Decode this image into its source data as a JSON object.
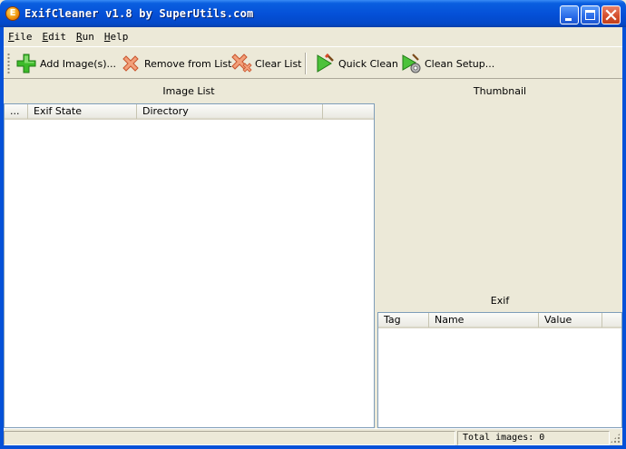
{
  "window": {
    "title": "ExifCleaner v1.8 by SuperUtils.com",
    "app_icon_glyph": "E"
  },
  "menu": [
    {
      "label": "File"
    },
    {
      "label": "Edit"
    },
    {
      "label": "Run"
    },
    {
      "label": "Help"
    }
  ],
  "toolbar": {
    "add_images": "Add Image(s)...",
    "remove_from_list": "Remove from List",
    "clear_list": "Clear List",
    "quick_clean": "Quick Clean",
    "clean_setup": "Clean Setup..."
  },
  "image_list": {
    "title": "Image List",
    "columns": [
      "...",
      "Exif State",
      "Directory",
      ""
    ]
  },
  "thumbnail": {
    "title": "Thumbnail"
  },
  "exif": {
    "title": "Exif",
    "columns": [
      "Tag",
      "Name",
      "Value",
      ""
    ]
  },
  "status": {
    "total_images": "Total images: 0"
  },
  "colors": {
    "titlebar": "#0551d8",
    "face": "#ece9d8",
    "list_border": "#7f9db9"
  }
}
